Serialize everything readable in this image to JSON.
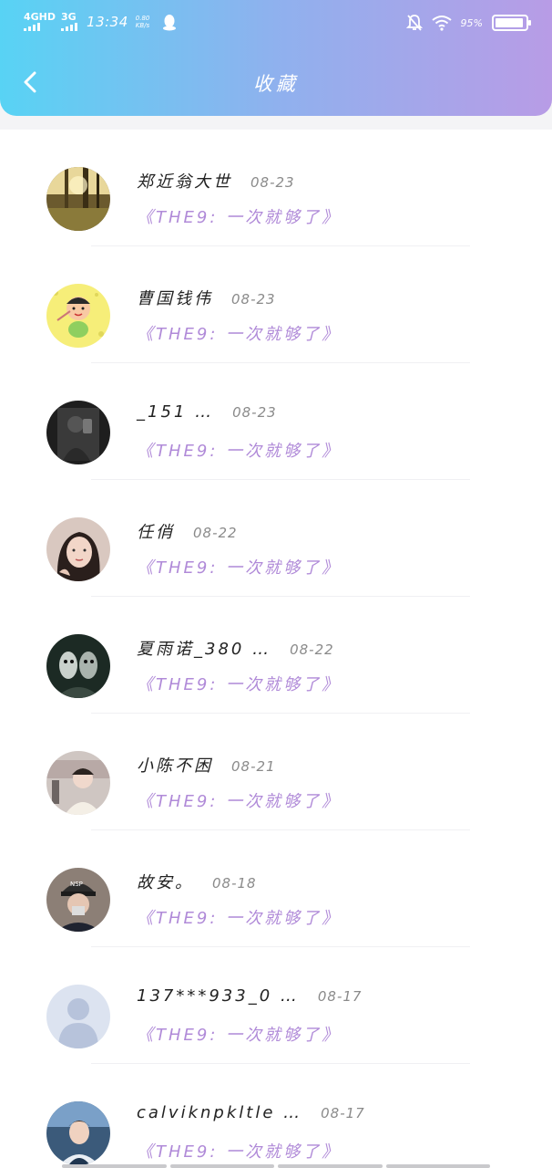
{
  "status_bar": {
    "network1": "4GHD",
    "network2": "3G",
    "time": "13:34",
    "speed_value": "0.80",
    "speed_unit": "KB/s",
    "battery_percent": "95%",
    "battery_level": 0.95
  },
  "header": {
    "title": "收藏",
    "back_icon": "chevron-left-icon"
  },
  "favorites": [
    {
      "name": "郑近翁大世",
      "date": "08-23",
      "song": "《THE9: 一次就够了》",
      "avatar": "forest"
    },
    {
      "name": "曹国钱伟",
      "date": "08-23",
      "song": "《THE9: 一次就够了》",
      "avatar": "cartoon"
    },
    {
      "name": "_151 …",
      "date": "08-23",
      "song": "《THE9: 一次就够了》",
      "avatar": "dark-selfie"
    },
    {
      "name": "任俏",
      "date": "08-22",
      "song": "《THE9: 一次就够了》",
      "avatar": "girl"
    },
    {
      "name": "夏雨诺_380 …",
      "date": "08-22",
      "song": "《THE9: 一次就够了》",
      "avatar": "dark-art"
    },
    {
      "name": "小陈不困",
      "date": "08-21",
      "song": "《THE9: 一次就够了》",
      "avatar": "street"
    },
    {
      "name": "故安。",
      "date": "08-18",
      "song": "《THE9: 一次就够了》",
      "avatar": "cap-boy"
    },
    {
      "name": "137***933_0 …",
      "date": "08-17",
      "song": "《THE9: 一次就够了》",
      "avatar": "default"
    },
    {
      "name": "calviknpkltle …",
      "date": "08-17",
      "song": "《THE9: 一次就够了》",
      "avatar": "boy"
    }
  ],
  "colors": {
    "header_gradient_start": "#58d3f4",
    "header_gradient_end": "#b89ce6",
    "song_text": "#b08ad8"
  }
}
